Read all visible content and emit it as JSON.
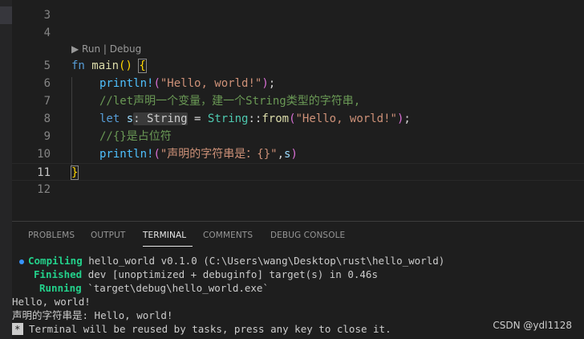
{
  "codelens": "▶ Run | Debug",
  "editor": {
    "line_numbers": [
      "3",
      "4",
      "5",
      "6",
      "7",
      "8",
      "9",
      "10",
      "11",
      "12"
    ],
    "line5": {
      "kw": "fn",
      "name": "main",
      "parens": "()",
      "brace": "{"
    },
    "line6": {
      "macro": "println!",
      "open": "(",
      "str": "\"Hello, world!\"",
      "close": ")",
      "semi": ";"
    },
    "line7": {
      "comment": "//let声明一个变量，建一个String类型的字符串,"
    },
    "line8": {
      "kw": "let",
      "var": "s",
      "hint": ": String",
      "eq": " = ",
      "type": "String",
      "sep": "::",
      "fn": "from",
      "open": "(",
      "str": "\"Hello, world!\"",
      "close": ")",
      "semi": ";"
    },
    "line9": {
      "comment": "//{}是占位符"
    },
    "line10": {
      "macro": "println!",
      "open": "(",
      "str": "\"声明的字符串是：{}\"",
      "comma": ",",
      "var": "s",
      "close": ")"
    },
    "line11": {
      "brace": "}"
    }
  },
  "panel": {
    "tabs": [
      "PROBLEMS",
      "OUTPUT",
      "TERMINAL",
      "COMMENTS",
      "DEBUG CONSOLE"
    ],
    "active_tab": "TERMINAL"
  },
  "terminal": {
    "l1": {
      "label": "Compiling",
      "text": " hello_world v0.1.0 (C:\\Users\\wang\\Desktop\\rust\\hello_world)"
    },
    "l2": {
      "label": "Finished",
      "text": " dev [unoptimized + debuginfo] target(s) in 0.46s"
    },
    "l3": {
      "label": "Running",
      "text": " `target\\debug\\hello_world.exe`"
    },
    "l4": "Hello, world!",
    "l5": "声明的字符串是: Hello, world!",
    "l6": {
      "marker": "*",
      "text": " Terminal will be reused by tasks, press any key to close it."
    }
  },
  "watermark": "CSDN @ydl1128",
  "colors": {
    "accent": "#3794ff",
    "keyword": "#569cd6",
    "string": "#ce9178",
    "comment": "#6a9955",
    "type": "#4ec9b0",
    "green": "#23d18b"
  }
}
